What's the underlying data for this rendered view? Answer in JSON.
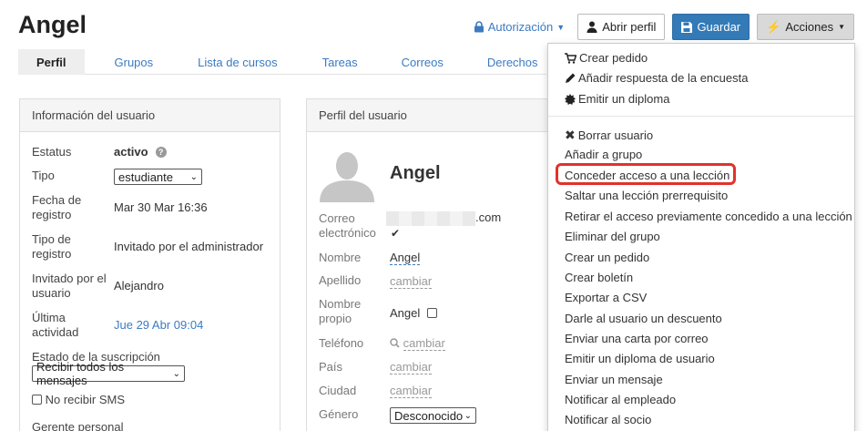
{
  "header": {
    "user_name": "Angel"
  },
  "toolbar": {
    "authorization_label": "Autorización",
    "open_profile_label": "Abrir perfil",
    "save_label": "Guardar",
    "actions_label": "Acciones"
  },
  "tabs": [
    {
      "label": "Perfil"
    },
    {
      "label": "Grupos"
    },
    {
      "label": "Lista de cursos"
    },
    {
      "label": "Tareas"
    },
    {
      "label": "Correos"
    },
    {
      "label": "Derechos"
    }
  ],
  "user_info": {
    "title": "Información del usuario",
    "status_label": "Estatus",
    "status_value": "activo",
    "type_label": "Tipo",
    "type_value": "estudiante",
    "reg_date_label_1": "Fecha de",
    "reg_date_label_2": "registro",
    "reg_date_value": "Mar 30 Mar 16:36",
    "reg_type_label_1": "Tipo de",
    "reg_type_label_2": "registro",
    "reg_type_value": "Invitado por el administrador",
    "invited_by_label_1": "Invitado por el",
    "invited_by_label_2": "usuario",
    "invited_by_value": "Alejandro",
    "last_activity_label_1": "Última",
    "last_activity_label_2": "actividad",
    "last_activity_value": "Jue 29 Abr 09:04",
    "subscription_label": "Estado de la suscripción",
    "subscription_value": "Recibir todos los mensajes",
    "no_sms_label": "No recibir SMS",
    "manager_label": "Gerente personal"
  },
  "user_profile": {
    "title": "Perfil del usuario",
    "name_display": "Angel",
    "email_label_1": "Correo",
    "email_label_2": "electrónico",
    "email_suffix": ".com",
    "email_verified_mark": "✔",
    "first_name_label": "Nombre",
    "first_name_value": "Angel",
    "last_name_label": "Apellido",
    "last_name_value": "cambiar",
    "own_name_label_1": "Nombre",
    "own_name_label_2": "propio",
    "own_name_value": "Angel",
    "phone_label": "Teléfono",
    "phone_value": "cambiar",
    "country_label": "País",
    "country_value": "cambiar",
    "city_label": "Ciudad",
    "city_value": "cambiar",
    "gender_label": "Género",
    "gender_value": "Desconocido"
  },
  "actions_menu": {
    "items": [
      "Crear pedido",
      "Añadir respuesta de la encuesta",
      "Emitir un diploma",
      "Borrar usuario",
      "Añadir a grupo",
      "Conceder acceso a una lección",
      "Saltar una lección prerrequisito",
      "Retirar el acceso previamente concedido a una lección",
      "Eliminar del grupo",
      "Crear un pedido",
      "Crear boletín",
      "Exportar a CSV",
      "Darle al usuario un descuento",
      "Enviar una carta por correo",
      "Emitir un diploma de usuario",
      "Enviar un mensaje",
      "Notificar al empleado",
      "Notificar al socio"
    ]
  },
  "colors": {
    "link": "#3c7ac1",
    "primary": "#337ab7",
    "highlight": "#e0332b"
  }
}
